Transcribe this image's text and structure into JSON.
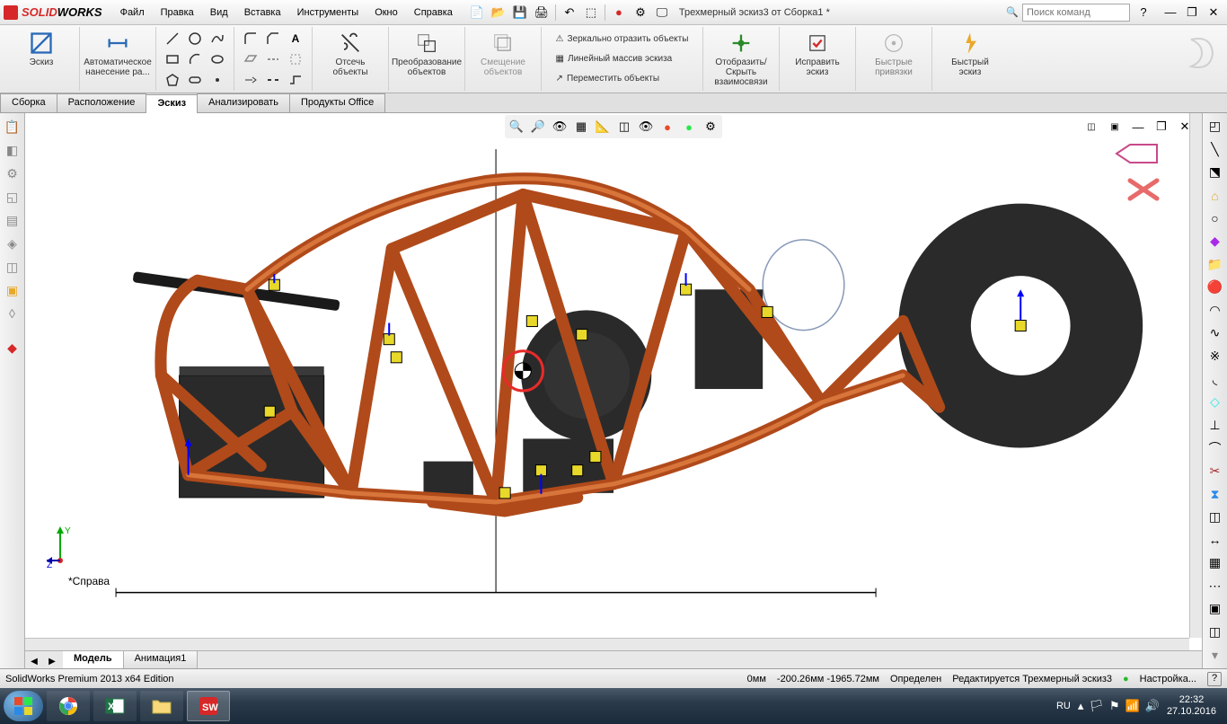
{
  "app": {
    "logo_text_1": "SOLID",
    "logo_text_2": "WORKS",
    "doc_name": "Трехмерный эскиз3 от Сборка1 *",
    "search_placeholder": "Поиск команд"
  },
  "menu": {
    "file": "Файл",
    "edit": "Правка",
    "view": "Вид",
    "insert": "Вставка",
    "tools": "Инструменты",
    "window": "Окно",
    "help": "Справка"
  },
  "ribbon": {
    "sketch": "Эскиз",
    "autodim": "Автоматическое нанесение ра...",
    "trim": "Отсечь объекты",
    "convert": "Преобразование объектов",
    "offset": "Смещение объектов",
    "mirror": "Зеркально отразить объекты",
    "linear": "Линейный массив эскиза",
    "move": "Переместить объекты",
    "showHide": "Отобразить/Скрыть взаимосвязи",
    "repair": "Исправить эскиз",
    "quickSnap": "Быстрые привязки",
    "rapidSketch": "Быстрый эскиз"
  },
  "tabs": {
    "assembly": "Сборка",
    "layout": "Расположение",
    "sketch": "Эскиз",
    "evaluate": "Анализировать",
    "office": "Продукты Office"
  },
  "viewport": {
    "view_label": "*Справа",
    "model_tab": "Модель",
    "anim_tab": "Анимация1",
    "axis_y": "Y",
    "axis_z": "Z"
  },
  "status": {
    "edition": "SolidWorks Premium 2013 x64 Edition",
    "dim": "0мм",
    "coords": "-200.26мм -1965.72мм",
    "state": "Определен",
    "editing": "Редактируется Трехмерный эскиз3",
    "custom": "Настройка...",
    "help": "?"
  },
  "taskbar": {
    "lang": "RU",
    "time": "22:32",
    "date": "27.10.2016"
  }
}
